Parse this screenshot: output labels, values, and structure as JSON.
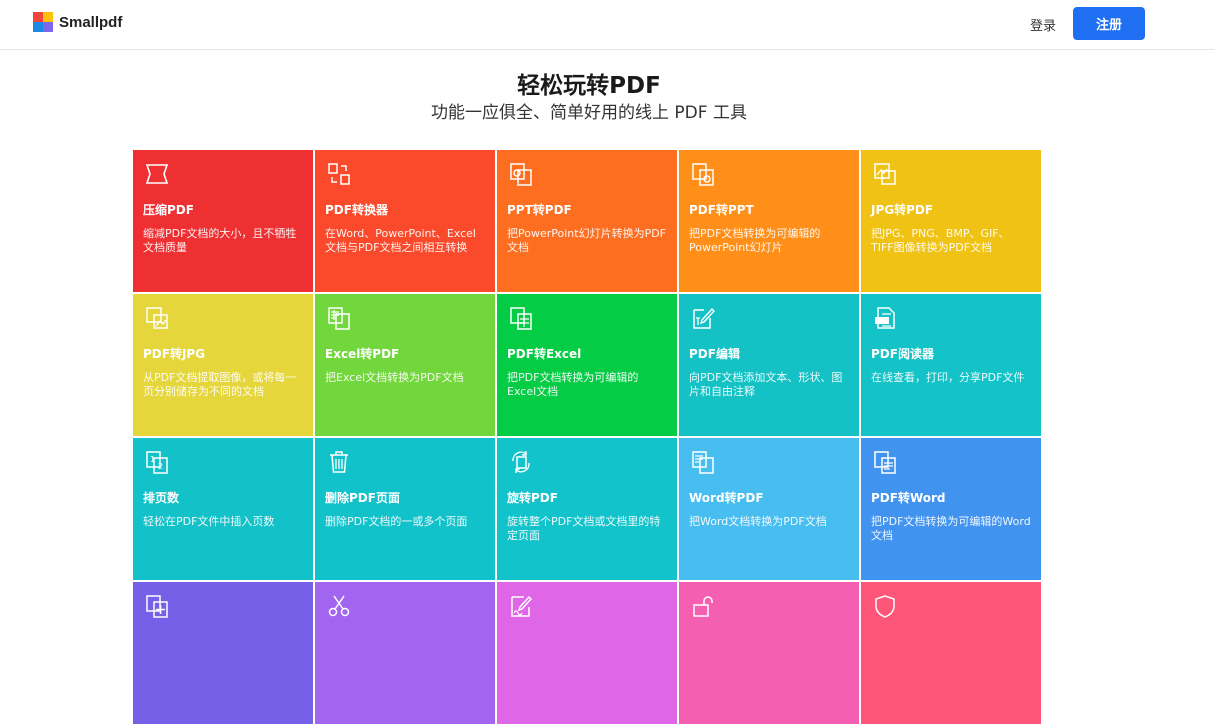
{
  "header": {
    "logo_text": "Smallpdf",
    "logo_colors": [
      "#f2453d",
      "#ffc107",
      "#1e88e5",
      "#7b68ee"
    ],
    "login_label": "登录",
    "signup_label": "注册"
  },
  "hero": {
    "title": "轻松玩转PDF",
    "subtitle": "功能一应俱全、简单好用的线上 PDF 工具"
  },
  "tools": [
    {
      "title": "压缩PDF",
      "desc": "缩减PDF文档的大小，且不牺牲文档质量",
      "color": "#ee3032",
      "icon": "compress-icon"
    },
    {
      "title": "PDF转换器",
      "desc": "在Word、PowerPoint、Excel文档与PDF文档之间相互转换",
      "color": "#fb4a2b",
      "icon": "converter-icon"
    },
    {
      "title": "PPT转PDF",
      "desc": "把PowerPoint幻灯片转换为PDF文档",
      "color": "#fd6e20",
      "icon": "ppt-to-pdf-icon"
    },
    {
      "title": "PDF转PPT",
      "desc": "把PDF文档转换为可编辑的PowerPoint幻灯片",
      "color": "#ff8f19",
      "icon": "pdf-to-ppt-icon"
    },
    {
      "title": "JPG转PDF",
      "desc": "把JPG、PNG、BMP、GIF、TIFF图像转换为PDF文档",
      "color": "#f0c213",
      "icon": "jpg-to-pdf-icon"
    },
    {
      "title": "PDF转JPG",
      "desc": "从PDF文档提取图像，或将每一页分别储存为不同的文档",
      "color": "#e4d63b",
      "icon": "pdf-to-jpg-icon"
    },
    {
      "title": "Excel转PDF",
      "desc": "把Excel文档转换为PDF文档",
      "color": "#72d63d",
      "icon": "excel-to-pdf-icon"
    },
    {
      "title": "PDF转Excel",
      "desc": "把PDF文档转换为可编辑的Excel文档",
      "color": "#05cc45",
      "icon": "pdf-to-excel-icon"
    },
    {
      "title": "PDF编辑",
      "desc": "向PDF文档添加文本、形状、图片和自由注释",
      "color": "#14c2c5",
      "icon": "edit-pdf-icon"
    },
    {
      "title": "PDF阅读器",
      "desc": "在线查看，打印，分享PDF文件",
      "color": "#13c3c7",
      "icon": "reader-icon"
    },
    {
      "title": "排页数",
      "desc": "轻松在PDF文件中插入页数",
      "color": "#13c2c9",
      "icon": "page-number-icon"
    },
    {
      "title": "删除PDF页面",
      "desc": "删除PDF文档的一或多个页面",
      "color": "#11c2cb",
      "icon": "trash-icon"
    },
    {
      "title": "旋转PDF",
      "desc": "旋转整个PDF文档或文档里的特定页面",
      "color": "#12c3cb",
      "icon": "rotate-icon"
    },
    {
      "title": "Word转PDF",
      "desc": "把Word文档转换为PDF文档",
      "color": "#48bef0",
      "icon": "word-to-pdf-icon"
    },
    {
      "title": "PDF转Word",
      "desc": "把PDF文档转换为可编辑的Word文档",
      "color": "#4193f0",
      "icon": "pdf-to-word-icon"
    },
    {
      "title": "",
      "desc": "",
      "color": "#7760e8",
      "icon": "merge-icon"
    },
    {
      "title": "",
      "desc": "",
      "color": "#a265f0",
      "icon": "scissors-icon"
    },
    {
      "title": "",
      "desc": "",
      "color": "#e066e8",
      "icon": "esign-icon"
    },
    {
      "title": "",
      "desc": "",
      "color": "#f45fb1",
      "icon": "unlock-icon"
    },
    {
      "title": "",
      "desc": "",
      "color": "#fd5679",
      "icon": "shield-icon"
    }
  ]
}
